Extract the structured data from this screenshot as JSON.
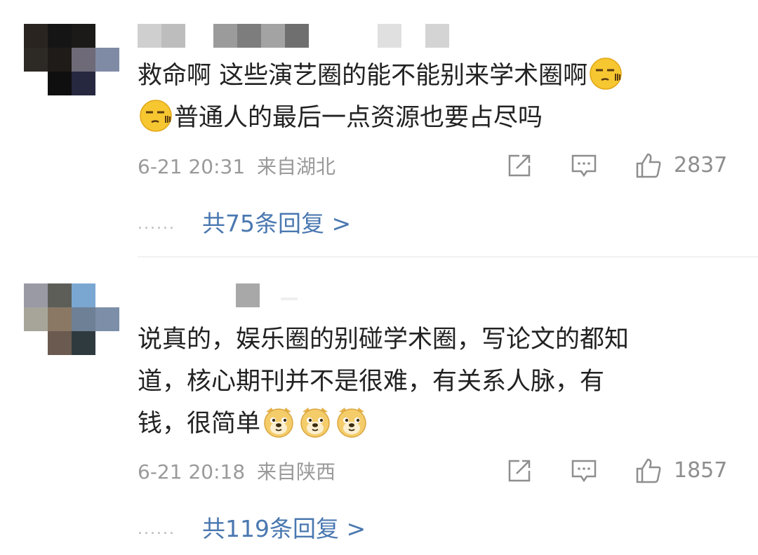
{
  "comments": [
    {
      "text_line1": "救命啊 这些演艺圈的能不能别来学术圈啊",
      "text_line2": "普通人的最后一点资源也要占尽吗",
      "date": "6-21 20:31",
      "location": "来自湖北",
      "likes": "2837",
      "replies_label": "共75条回复 >",
      "dots": "......",
      "emoji": "speechless-face-emoji"
    },
    {
      "text_line1": "说真的，娱乐圈的别碰学术圈，写论文的都知",
      "text_line2": "道，核心期刊并不是很难，有关系人脉，有",
      "text_line3": "钱，很简单",
      "date": "6-21 20:18",
      "location": "来自陕西",
      "likes": "1857",
      "replies_label": "共119条回复 >",
      "dots": "......",
      "emoji": "doge-emoji"
    }
  ],
  "icons": {
    "share": "share-icon",
    "comment": "comment-icon",
    "like": "thumbs-up-icon"
  },
  "colors": {
    "text": "#222222",
    "meta": "#9a9a9a",
    "link": "#4a78b0",
    "divider": "#f1f1f1"
  }
}
